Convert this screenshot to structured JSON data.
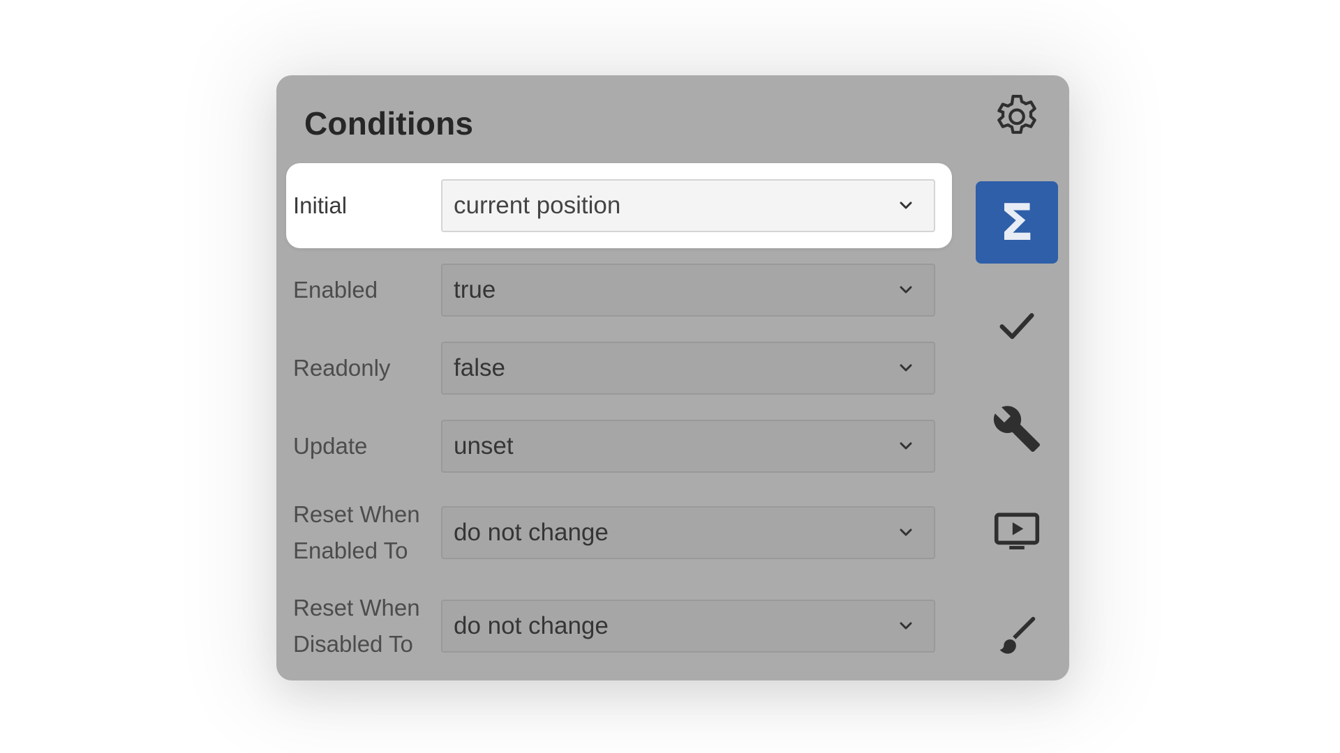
{
  "panel": {
    "title": "Conditions"
  },
  "rows": [
    {
      "label": "Initial",
      "value": "current position",
      "highlighted": true
    },
    {
      "label": "Enabled",
      "value": "true"
    },
    {
      "label": "Readonly",
      "value": "false"
    },
    {
      "label": "Update",
      "value": "unset"
    },
    {
      "label_line1": "Reset When",
      "label_line2": "Enabled To",
      "value": "do not change"
    },
    {
      "label_line1": "Reset When",
      "label_line2": "Disabled To",
      "value": "do not change"
    }
  ],
  "sidebar": {
    "icons": [
      "gear-icon",
      "sigma-icon",
      "checkmark-icon",
      "wrench-icon",
      "play-screen-icon",
      "brush-icon"
    ],
    "active_icon": "sigma-icon",
    "sigma_glyph": "Σ"
  },
  "colors": {
    "overlay": "#ababab",
    "active_accent": "#2e5fa8",
    "highlight_bg": "#ffffff"
  }
}
